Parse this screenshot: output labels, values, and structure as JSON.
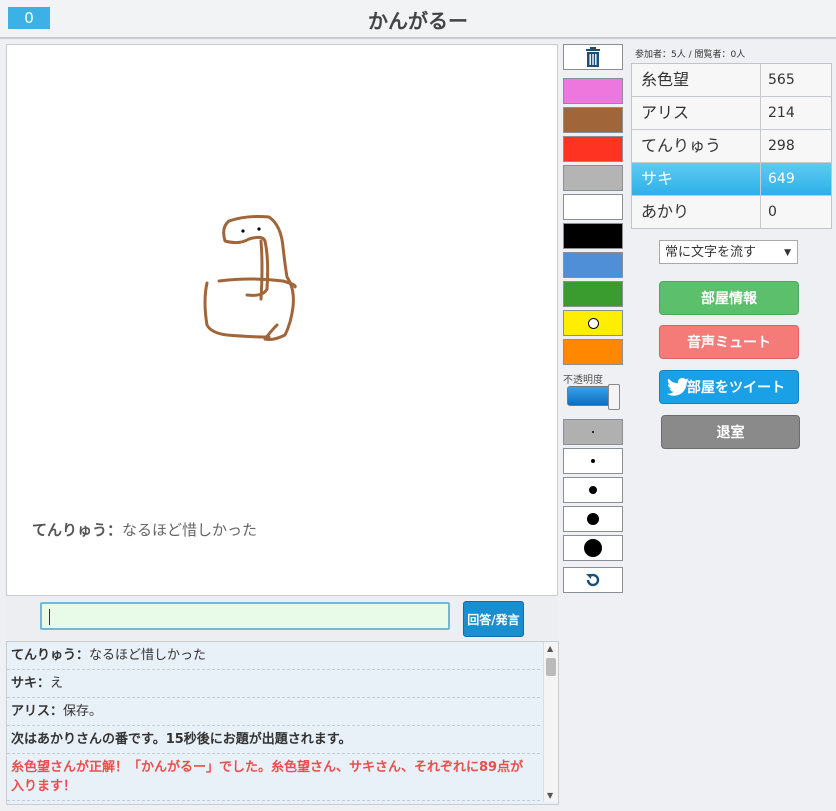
{
  "header": {
    "score": "0",
    "title": "かんがるー"
  },
  "canvas": {
    "overlay_user": "てんりゅう：",
    "overlay_text": "なるほど惜しかった"
  },
  "input": {
    "value": "",
    "submit_label": "回答/発言"
  },
  "chat": {
    "lines": [
      {
        "user": "てんりゅう：",
        "text": "なるほど惜しかった"
      },
      {
        "user": "サキ：",
        "text": "え"
      },
      {
        "user": "アリス：",
        "text": "保存。"
      },
      {
        "system": "次はあかりさんの番です。15秒後にお題が出題されます。"
      },
      {
        "correct": "糸色望さんが正解！「かんがるー」でした。糸色望さん、サキさん、それぞれに89点が入ります！"
      }
    ]
  },
  "tools": {
    "colors": [
      "#ee77dd",
      "#a0663a",
      "#ff3322",
      "#b4b4b4",
      "#ffffff",
      "#000000",
      "#4f8fd8",
      "#3a9c2e",
      "#ffee00",
      "#ff8800"
    ],
    "opacity_label": "不透明度",
    "opacity_value": 1.0
  },
  "room": {
    "participants_info": "参加者：5人 / 閲覧者：0人",
    "players": [
      {
        "name": "糸色望",
        "score": "565"
      },
      {
        "name": "アリス",
        "score": "214"
      },
      {
        "name": "てんりゅう",
        "score": "298"
      },
      {
        "name": "サキ",
        "score": "649"
      },
      {
        "name": "あかり",
        "score": "0"
      }
    ],
    "scroll_mode": "常に文字を流す",
    "room_info_label": "部屋情報",
    "mute_label": "音声ミュート",
    "tweet_label": "部屋をツイート",
    "exit_label": "退室"
  },
  "style": {
    "accent": "#3bb1e6",
    "active_row": "#2db0e8",
    "correct_text": "#ec4d4d"
  }
}
